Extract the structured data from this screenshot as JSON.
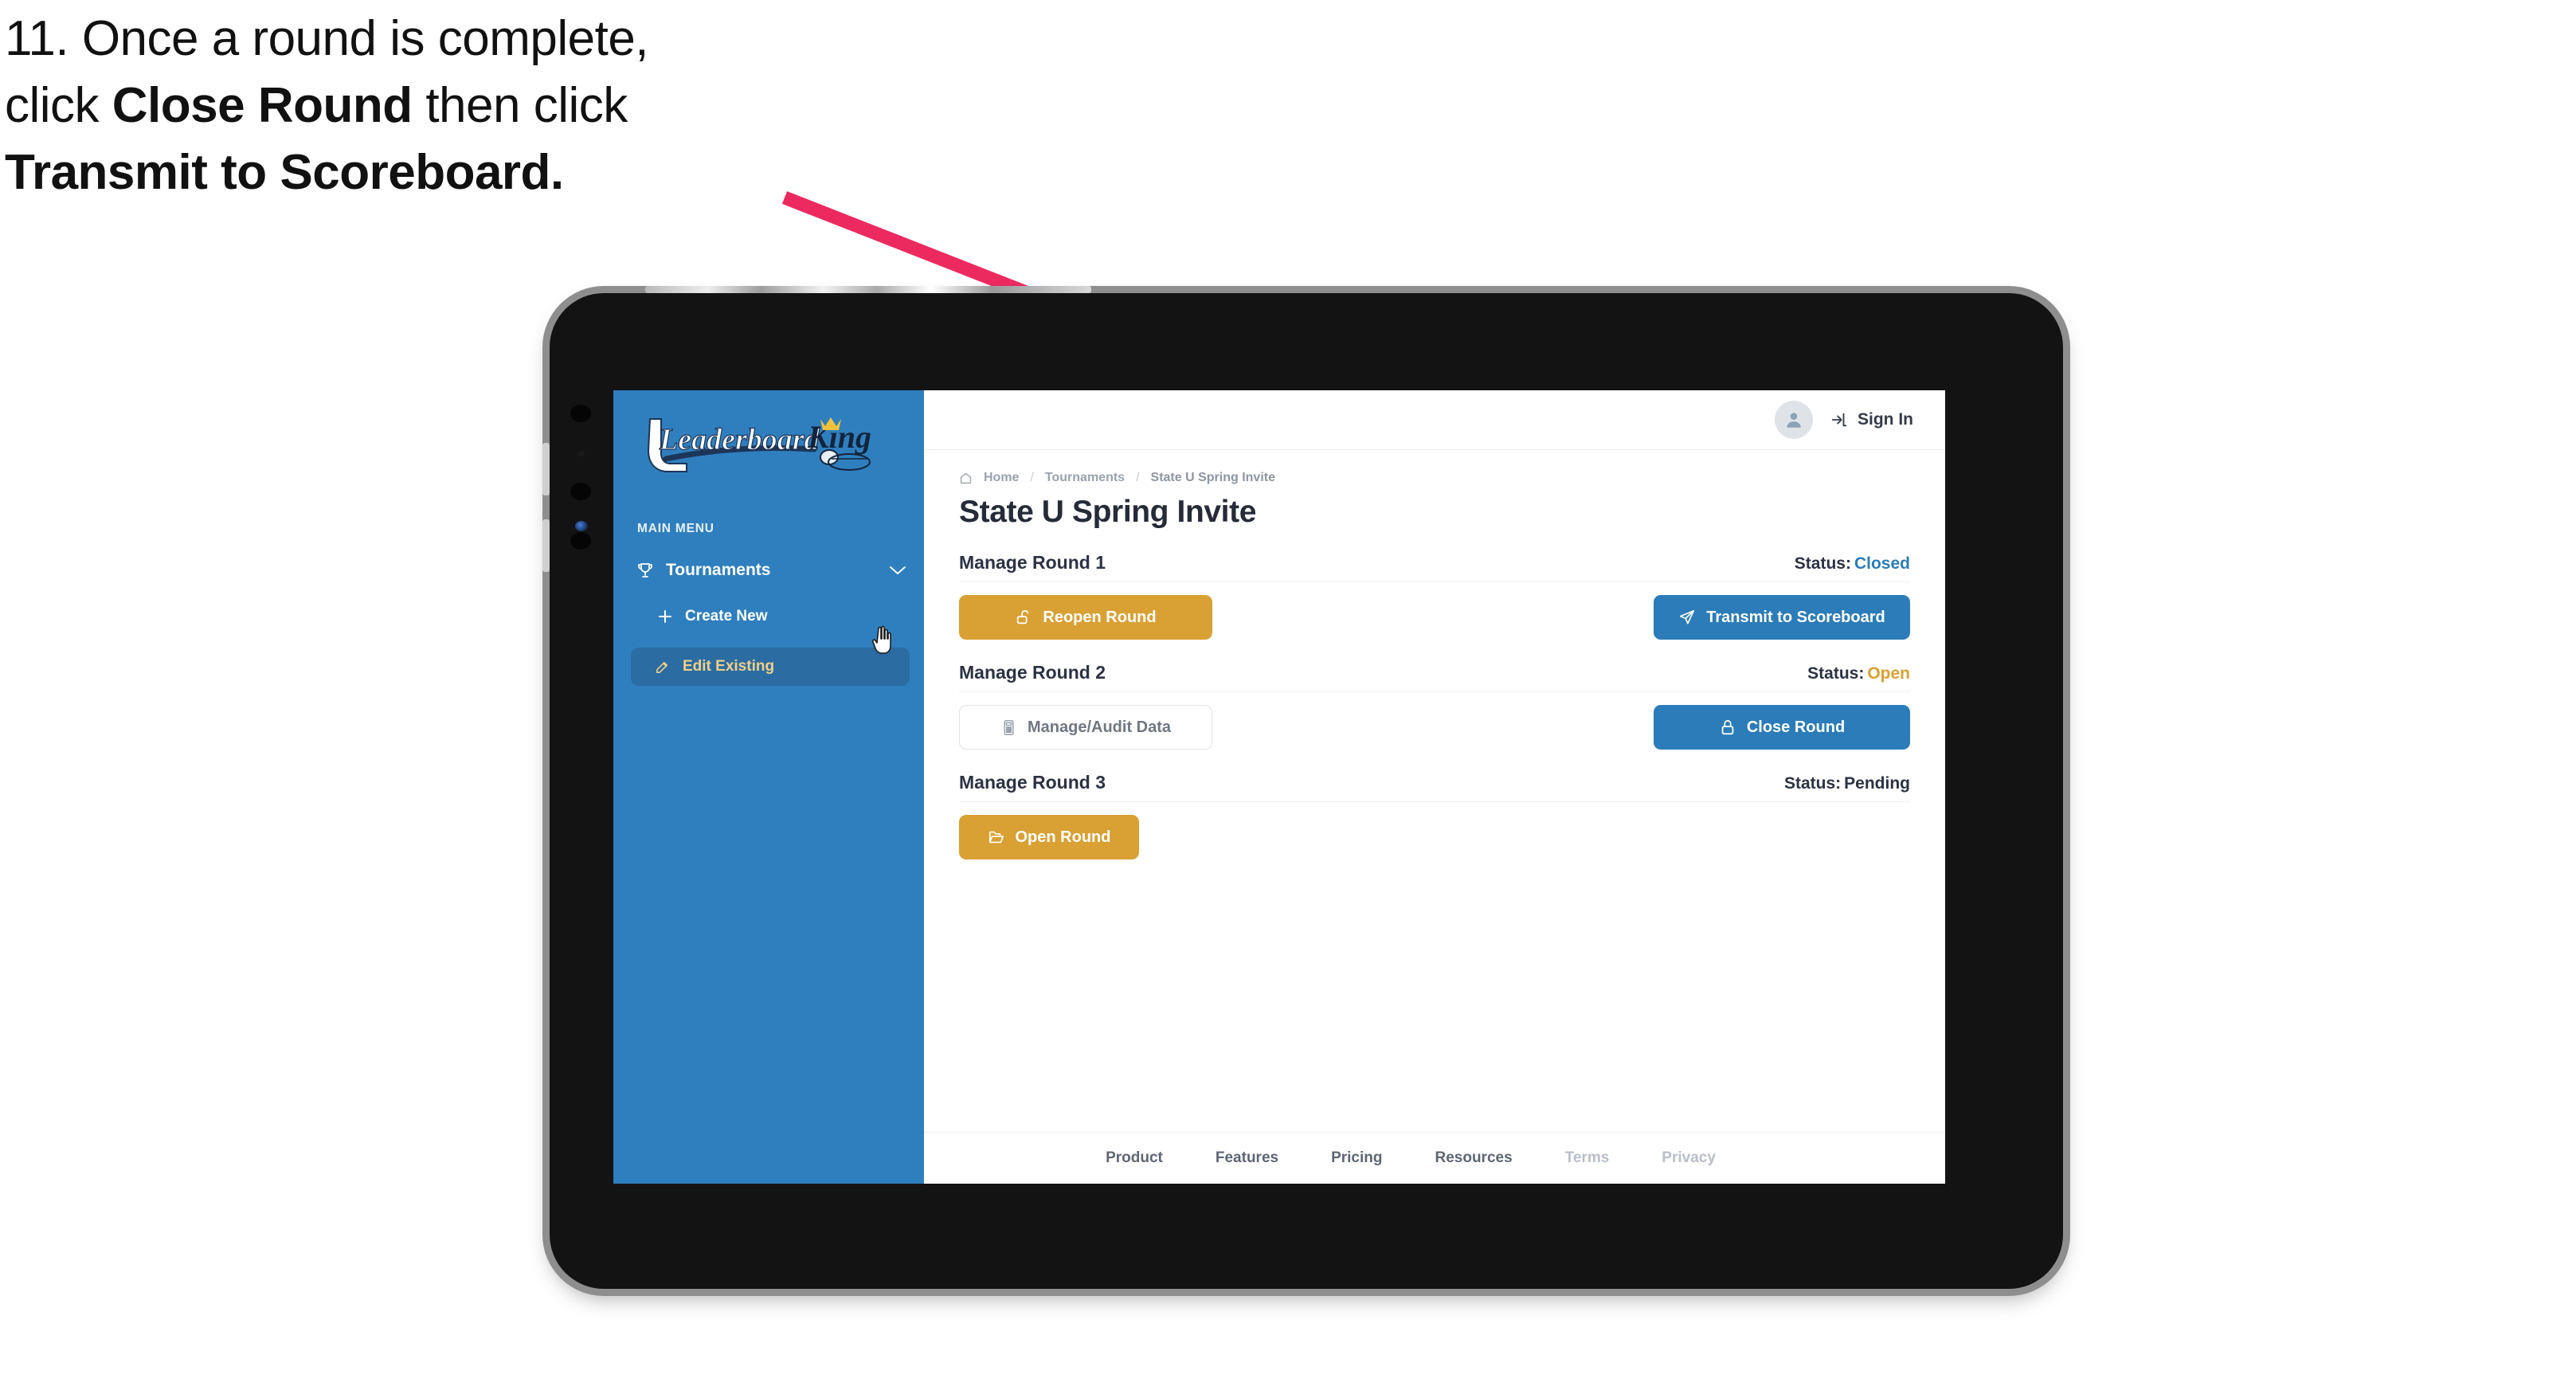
{
  "caption": {
    "line1_plain": "11. Once a round is complete,",
    "line2_pre": "click ",
    "line2_bold": "Close Round",
    "line2_post": " then click",
    "line3_bold": "Transmit to Scoreboard."
  },
  "colors": {
    "accent_pink": "#ec2a60",
    "sidebar_blue": "#2f7fbe",
    "sidebar_active": "#2b6ca3",
    "sidebar_active_text": "#f2cf86",
    "gold_button": "#d9a033",
    "blue_button": "#2b7cb8",
    "status_closed": "#2b7cb8",
    "status_open": "#d9a033",
    "status_pending": "#2b3244",
    "title_text": "#252b38"
  },
  "sidebar": {
    "logo_primary": "Leaderboard",
    "logo_secondary": "King",
    "menu_label": "MAIN MENU",
    "nav": {
      "label": "Tournaments",
      "icon": "trophy-icon",
      "chevron": "chevron-down-icon"
    },
    "items": [
      {
        "label": "Create New",
        "icon": "plus-icon",
        "active": false
      },
      {
        "label": "Edit Existing",
        "icon": "edit-pencil-icon",
        "active": true
      }
    ]
  },
  "topbar": {
    "avatar_icon": "user-avatar-icon",
    "signin_icon": "sign-in-arrow-icon",
    "signin_label": "Sign In"
  },
  "breadcrumb": {
    "home_icon": "home-icon",
    "items": [
      "Home",
      "Tournaments",
      "State U Spring Invite"
    ],
    "separator": "/"
  },
  "page": {
    "title": "State U Spring Invite"
  },
  "rounds": [
    {
      "title": "Manage Round 1",
      "status_label": "Status:",
      "status_value": "Closed",
      "status_color": "#2b7cb8",
      "left_button": {
        "label": "Reopen Round",
        "icon": "unlock-icon",
        "style": "gold"
      },
      "right_button": {
        "label": "Transmit to Scoreboard",
        "icon": "paper-plane-icon",
        "style": "blue"
      }
    },
    {
      "title": "Manage Round 2",
      "status_label": "Status:",
      "status_value": "Open",
      "status_color": "#d9a033",
      "left_button": {
        "label": "Manage/Audit Data",
        "icon": "calculator-icon",
        "style": "ghost"
      },
      "right_button": {
        "label": "Close Round",
        "icon": "lock-icon",
        "style": "blue"
      }
    },
    {
      "title": "Manage Round 3",
      "status_label": "Status:",
      "status_value": "Pending",
      "status_color": "#2b3244",
      "left_button": {
        "label": "Open Round",
        "icon": "folder-open-icon",
        "style": "gold"
      },
      "right_button": null
    }
  ],
  "footer": {
    "links": [
      {
        "label": "Product",
        "muted": false
      },
      {
        "label": "Features",
        "muted": false
      },
      {
        "label": "Pricing",
        "muted": false
      },
      {
        "label": "Resources",
        "muted": false
      },
      {
        "label": "Terms",
        "muted": true
      },
      {
        "label": "Privacy",
        "muted": true
      }
    ]
  },
  "annotation": {
    "arrow_icon": "pink-pointer-arrow",
    "cursor_icon": "pointing-hand-cursor"
  }
}
